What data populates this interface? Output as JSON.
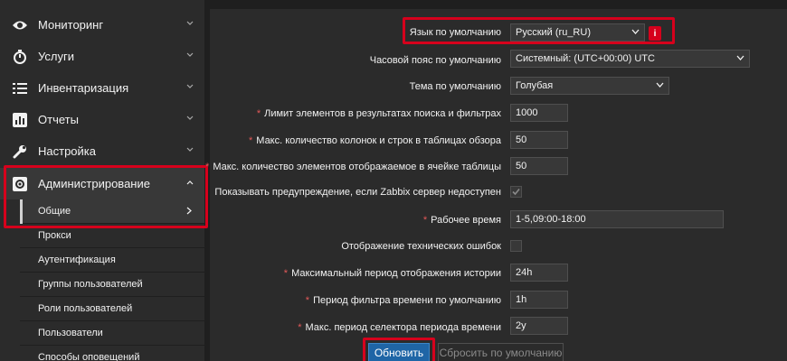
{
  "sidebar": {
    "menu": [
      {
        "label": "Мониторинг",
        "icon": "eye-icon"
      },
      {
        "label": "Услуги",
        "icon": "clock-icon"
      },
      {
        "label": "Инвентаризация",
        "icon": "list-icon"
      },
      {
        "label": "Отчеты",
        "icon": "chart-icon"
      },
      {
        "label": "Настройка",
        "icon": "wrench-icon"
      },
      {
        "label": "Администрирование",
        "icon": "gear-icon"
      }
    ],
    "submenu": [
      {
        "label": "Общие"
      },
      {
        "label": "Прокси"
      },
      {
        "label": "Аутентификация"
      },
      {
        "label": "Группы пользователей"
      },
      {
        "label": "Роли пользователей"
      },
      {
        "label": "Пользователи"
      },
      {
        "label": "Способы оповещений"
      }
    ]
  },
  "form": {
    "language": {
      "label": "Язык по умолчанию",
      "value": "Русский (ru_RU)"
    },
    "timezone": {
      "label": "Часовой пояс по умолчанию",
      "value": "Системный: (UTC+00:00) UTC"
    },
    "theme": {
      "label": "Тема по умолчанию",
      "value": "Голубая"
    },
    "search_limit": {
      "label": "Лимит элементов в результатах поиска и фильтрах",
      "value": "1000"
    },
    "max_overview": {
      "label": "Макс. количество колонок и строк в таблицах обзора",
      "value": "50"
    },
    "max_cell": {
      "label": "Макс. количество элементов отображаемое в ячейке таблицы",
      "value": "50"
    },
    "server_warning": {
      "label": "Показывать предупреждение, если Zabbix сервер недоступен",
      "checked": true
    },
    "work_time": {
      "label": "Рабочее время",
      "value": "1-5,09:00-18:00"
    },
    "tech_errors": {
      "label": "Отображение технических ошибок",
      "checked": false
    },
    "max_history": {
      "label": "Максимальный период отображения истории",
      "value": "24h"
    },
    "time_filter": {
      "label": "Период фильтра времени по умолчанию",
      "value": "1h"
    },
    "max_period": {
      "label": "Макс. период селектора периода времени",
      "value": "2y"
    },
    "required_mark": "*",
    "info_badge": "i",
    "update_button": "Обновить",
    "reset_button": "Сбросить по умолчанию"
  },
  "colors": {
    "accent": "#1f65a6",
    "highlight": "#d6001c",
    "required": "#e45959"
  }
}
